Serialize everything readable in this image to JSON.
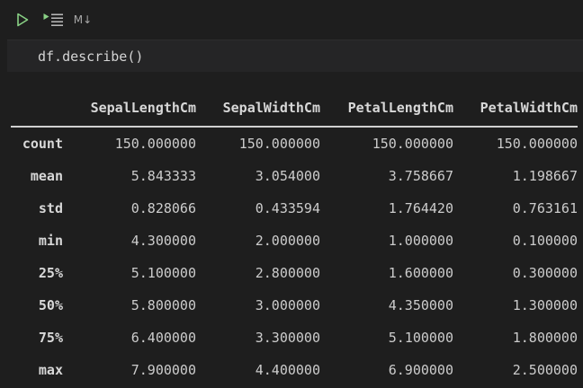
{
  "toolbar": {
    "run_icon": "play-icon",
    "run_below_icon": "run-below-icon",
    "markdown_label": "M↓"
  },
  "editor": {
    "code": "df.describe()"
  },
  "output": {
    "columns": [
      "",
      "SepalLengthCm",
      "SepalWidthCm",
      "PetalLengthCm",
      "PetalWidthCm"
    ],
    "rows": [
      {
        "index": "count",
        "values": [
          "150.000000",
          "150.000000",
          "150.000000",
          "150.000000"
        ]
      },
      {
        "index": "mean",
        "values": [
          "5.843333",
          "3.054000",
          "3.758667",
          "1.198667"
        ]
      },
      {
        "index": "std",
        "values": [
          "0.828066",
          "0.433594",
          "1.764420",
          "0.763161"
        ]
      },
      {
        "index": "min",
        "values": [
          "4.300000",
          "2.000000",
          "1.000000",
          "0.100000"
        ]
      },
      {
        "index": "25%",
        "values": [
          "5.100000",
          "2.800000",
          "1.600000",
          "0.300000"
        ]
      },
      {
        "index": "50%",
        "values": [
          "5.800000",
          "3.000000",
          "4.350000",
          "1.300000"
        ]
      },
      {
        "index": "75%",
        "values": [
          "6.400000",
          "3.300000",
          "5.100000",
          "1.800000"
        ]
      },
      {
        "index": "max",
        "values": [
          "7.900000",
          "4.400000",
          "6.900000",
          "2.500000"
        ]
      }
    ]
  },
  "colors": {
    "background": "#1e1e1e",
    "editor_background": "#252526",
    "run_green": "#89d185",
    "text": "#cccccc"
  }
}
